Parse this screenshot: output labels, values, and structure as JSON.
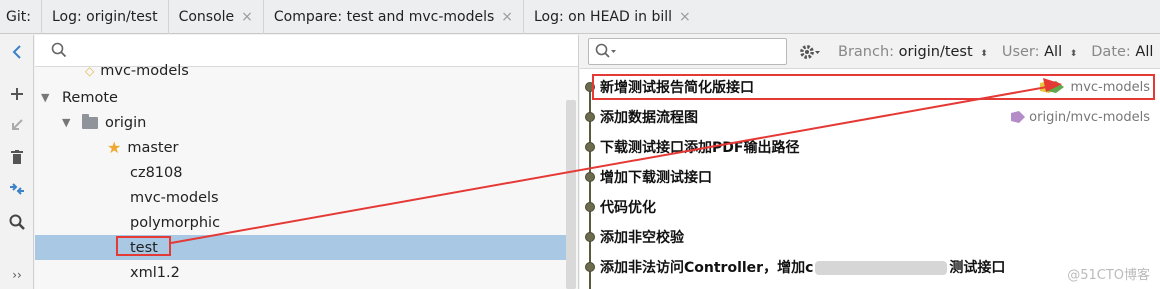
{
  "tabs": {
    "git_label": "Git:",
    "items": [
      {
        "label": "Log: origin/test",
        "closable": false
      },
      {
        "label": "Console",
        "closable": true
      },
      {
        "label": "Compare: test and mvc-models",
        "closable": true
      },
      {
        "label": "Log: on HEAD in bill",
        "closable": true
      }
    ],
    "close_glyph": "×"
  },
  "toolbar": {
    "icons": [
      "collapse-left-icon",
      "add-icon",
      "checkout-icon",
      "delete-icon",
      "compare-icon",
      "search-icon",
      "more-icon"
    ],
    "more_label": "››"
  },
  "tree": {
    "search_placeholder": "",
    "partial_item": "mvc-models",
    "remote_label": "Remote",
    "origin_label": "origin",
    "branches": [
      "master",
      "cz8108",
      "mvc-models",
      "polymorphic",
      "test",
      "xml1.2"
    ],
    "selected_branch": "test"
  },
  "log": {
    "search_placeholder": "",
    "branch_filter": {
      "label": "Branch:",
      "value": "origin/test"
    },
    "user_filter": {
      "label": "User:",
      "value": "All"
    },
    "date_filter": {
      "label": "Date:",
      "value": "All"
    },
    "sort_glyph": "⬍",
    "commits": [
      {
        "message": "新增测试报告简化版接口",
        "ref": "mvc-models"
      },
      {
        "message": "添加数据流程图",
        "ref": "origin/mvc-models"
      },
      {
        "message": "下载测试接口添加PDF输出路径",
        "ref": ""
      },
      {
        "message": "增加下载测试接口",
        "ref": ""
      },
      {
        "message": "代码优化",
        "ref": ""
      },
      {
        "message": "添加非空校验",
        "ref": ""
      },
      {
        "message_start": "添加非法访问Controller，增加c",
        "message_end": "测试接口",
        "ref": ""
      }
    ],
    "watermark": "@51CTO博客"
  },
  "colors": {
    "highlight": "#e53935",
    "selection": "#a8c8e4",
    "accent_blue": "#3d82c7"
  }
}
